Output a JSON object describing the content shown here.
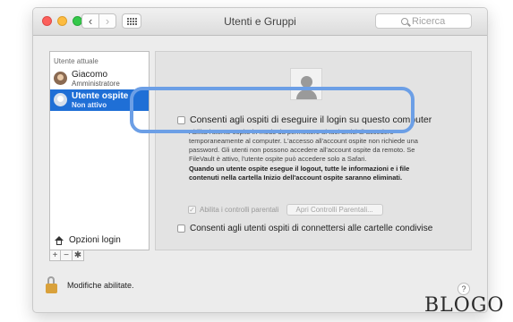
{
  "window": {
    "title": "Utenti e Gruppi",
    "search_placeholder": "Ricerca"
  },
  "sidebar": {
    "section_label": "Utente attuale",
    "users": [
      {
        "name": "Giacomo",
        "role": "Amministratore",
        "selected": false
      },
      {
        "name": "Utente ospite",
        "role": "Non attivo",
        "selected": true
      }
    ],
    "login_options": "Opzioni login",
    "tools": {
      "add": "+",
      "remove": "−",
      "settings": "✱"
    }
  },
  "pane": {
    "option1": "Consenti agli ospiti di eseguire il login su questo computer",
    "option1_checked": false,
    "desc_para1": "Abilita l'utente ospite in modo da permettere ai tuoi amici di accedere temporaneamente al computer. L'accesso all'account ospite non richiede una password. Gli utenti non possono accedere all'account ospite da remoto. Se FileVault è attivo, l'utente ospite può accedere solo a Safari.",
    "desc_para2": "Quando un utente ospite esegue il logout, tutte le informazioni e i file contenuti nella cartella Inizio dell'account ospite saranno eliminati.",
    "parental_label": "Abilita i controlli parentali",
    "parental_checked": true,
    "parental_button": "Apri Controlli Parentali...",
    "option2": "Consenti agli utenti ospiti di connettersi alle cartelle condivise",
    "option2_checked": false
  },
  "footer": {
    "lock_text": "Modifiche abilitate.",
    "help": "?"
  },
  "watermark": "BLOGO",
  "colors": {
    "selection": "#1f6fd6",
    "highlight_ring": "#6c9fe6",
    "lock": "#d9a13b"
  }
}
